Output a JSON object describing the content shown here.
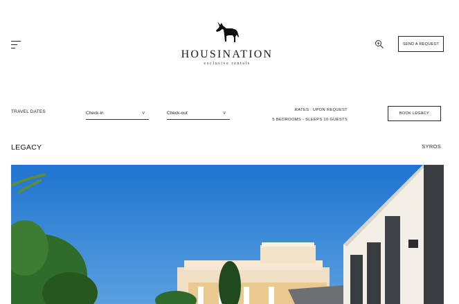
{
  "header": {
    "menu_icon": "hamburger-icon",
    "logo_text": "HOUSINATION",
    "logo_sub": "exclusive rentals",
    "search_icon": "zoom-search-icon",
    "send_request_label": "SEND A REQUEST"
  },
  "booking": {
    "travel_dates_label": "TRAVEL DATES",
    "checkin_placeholder": "Check-in",
    "checkout_placeholder": "Check-out",
    "rates_text": "RATES : UPON REQUEST",
    "capacity_text": "5 BEDROOMS - SLEEPS 10 GUESTS",
    "book_label": "BOOK LEGACY"
  },
  "property": {
    "title": "LEGACY",
    "location": "SYROS"
  },
  "colors": {
    "sky": "#2b7fd1",
    "text": "#111111",
    "border": "#222222"
  }
}
